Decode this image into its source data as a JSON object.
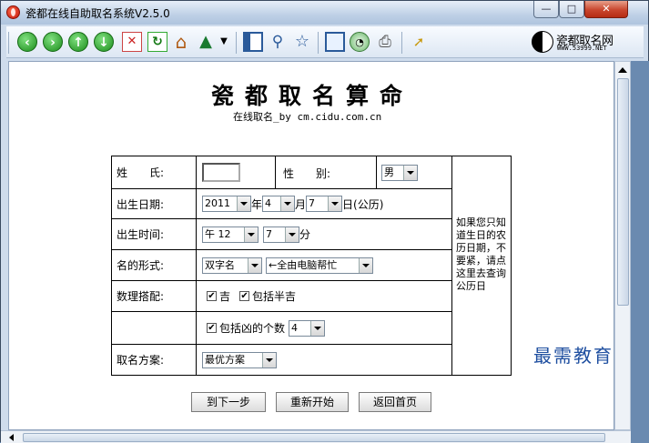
{
  "window": {
    "title": "瓷都在线自助取名系统V2.5.0",
    "min": "—",
    "max": "□",
    "close": "✕"
  },
  "toolbar": {
    "icons": [
      "back-icon",
      "forward-icon",
      "up-icon",
      "down-icon",
      "stop-icon",
      "refresh-icon",
      "home-icon",
      "tree-icon",
      "dropdown-icon",
      "panel-icon",
      "search-icon",
      "favorites-icon",
      "screen-icon",
      "history-icon",
      "print-icon",
      "pointer-icon"
    ],
    "logo_text": "瓷都取名网",
    "logo_sub": "WWW.53999.NET"
  },
  "page": {
    "title": "瓷都取名算命",
    "subtitle": "在线取名_by cm.cidu.com.cn"
  },
  "form": {
    "surname_label": "姓　　氏:",
    "surname_value": "",
    "gender_label": "性　　别:",
    "gender_value": "男",
    "birthdate_label": "出生日期:",
    "year": "2011",
    "year_unit": "年",
    "month": "4",
    "month_unit": "月",
    "day": "7",
    "day_unit": "日(公历)",
    "birthtime_label": "出生时间:",
    "hour": "午 12",
    "minute": "7",
    "minute_unit": "分",
    "nameform_label": "名的形式:",
    "name_type": "双字名",
    "name_source": "←全由电脑帮忙",
    "numbers_label": "数理搭配:",
    "ji_label": "吉",
    "ji_checked": "✔",
    "banji_label": "包括半吉",
    "banji_checked": "✔",
    "xiong_label": "包括凶的个数",
    "xiong_checked": "✔",
    "xiong_count": "4",
    "plan_label": "取名方案:",
    "plan_value": "最优方案",
    "note": "如果您只知道生日的农历日期，不要紧，请点这里去查询公历日"
  },
  "buttons": {
    "next": "到下一步",
    "reset": "重新开始",
    "home": "返回首页"
  },
  "watermark": "最需教育"
}
